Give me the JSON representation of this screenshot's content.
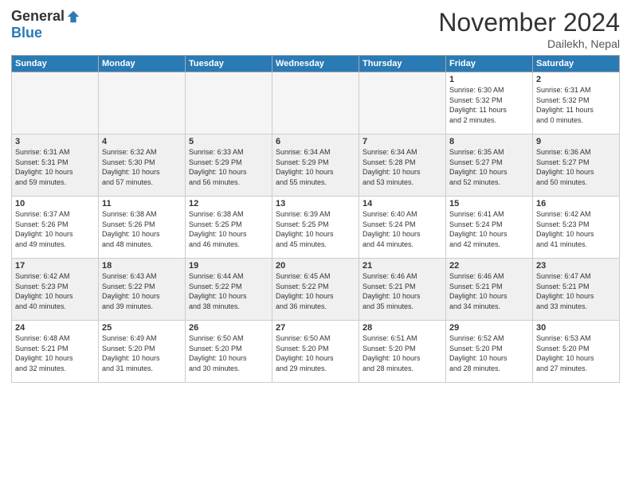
{
  "header": {
    "logo_general": "General",
    "logo_blue": "Blue",
    "month_title": "November 2024",
    "subtitle": "Dailekh, Nepal"
  },
  "weekdays": [
    "Sunday",
    "Monday",
    "Tuesday",
    "Wednesday",
    "Thursday",
    "Friday",
    "Saturday"
  ],
  "weeks": [
    [
      {
        "day": "",
        "info": ""
      },
      {
        "day": "",
        "info": ""
      },
      {
        "day": "",
        "info": ""
      },
      {
        "day": "",
        "info": ""
      },
      {
        "day": "",
        "info": ""
      },
      {
        "day": "1",
        "info": "Sunrise: 6:30 AM\nSunset: 5:32 PM\nDaylight: 11 hours\nand 2 minutes."
      },
      {
        "day": "2",
        "info": "Sunrise: 6:31 AM\nSunset: 5:32 PM\nDaylight: 11 hours\nand 0 minutes."
      }
    ],
    [
      {
        "day": "3",
        "info": "Sunrise: 6:31 AM\nSunset: 5:31 PM\nDaylight: 10 hours\nand 59 minutes."
      },
      {
        "day": "4",
        "info": "Sunrise: 6:32 AM\nSunset: 5:30 PM\nDaylight: 10 hours\nand 57 minutes."
      },
      {
        "day": "5",
        "info": "Sunrise: 6:33 AM\nSunset: 5:29 PM\nDaylight: 10 hours\nand 56 minutes."
      },
      {
        "day": "6",
        "info": "Sunrise: 6:34 AM\nSunset: 5:29 PM\nDaylight: 10 hours\nand 55 minutes."
      },
      {
        "day": "7",
        "info": "Sunrise: 6:34 AM\nSunset: 5:28 PM\nDaylight: 10 hours\nand 53 minutes."
      },
      {
        "day": "8",
        "info": "Sunrise: 6:35 AM\nSunset: 5:27 PM\nDaylight: 10 hours\nand 52 minutes."
      },
      {
        "day": "9",
        "info": "Sunrise: 6:36 AM\nSunset: 5:27 PM\nDaylight: 10 hours\nand 50 minutes."
      }
    ],
    [
      {
        "day": "10",
        "info": "Sunrise: 6:37 AM\nSunset: 5:26 PM\nDaylight: 10 hours\nand 49 minutes."
      },
      {
        "day": "11",
        "info": "Sunrise: 6:38 AM\nSunset: 5:26 PM\nDaylight: 10 hours\nand 48 minutes."
      },
      {
        "day": "12",
        "info": "Sunrise: 6:38 AM\nSunset: 5:25 PM\nDaylight: 10 hours\nand 46 minutes."
      },
      {
        "day": "13",
        "info": "Sunrise: 6:39 AM\nSunset: 5:25 PM\nDaylight: 10 hours\nand 45 minutes."
      },
      {
        "day": "14",
        "info": "Sunrise: 6:40 AM\nSunset: 5:24 PM\nDaylight: 10 hours\nand 44 minutes."
      },
      {
        "day": "15",
        "info": "Sunrise: 6:41 AM\nSunset: 5:24 PM\nDaylight: 10 hours\nand 42 minutes."
      },
      {
        "day": "16",
        "info": "Sunrise: 6:42 AM\nSunset: 5:23 PM\nDaylight: 10 hours\nand 41 minutes."
      }
    ],
    [
      {
        "day": "17",
        "info": "Sunrise: 6:42 AM\nSunset: 5:23 PM\nDaylight: 10 hours\nand 40 minutes."
      },
      {
        "day": "18",
        "info": "Sunrise: 6:43 AM\nSunset: 5:22 PM\nDaylight: 10 hours\nand 39 minutes."
      },
      {
        "day": "19",
        "info": "Sunrise: 6:44 AM\nSunset: 5:22 PM\nDaylight: 10 hours\nand 38 minutes."
      },
      {
        "day": "20",
        "info": "Sunrise: 6:45 AM\nSunset: 5:22 PM\nDaylight: 10 hours\nand 36 minutes."
      },
      {
        "day": "21",
        "info": "Sunrise: 6:46 AM\nSunset: 5:21 PM\nDaylight: 10 hours\nand 35 minutes."
      },
      {
        "day": "22",
        "info": "Sunrise: 6:46 AM\nSunset: 5:21 PM\nDaylight: 10 hours\nand 34 minutes."
      },
      {
        "day": "23",
        "info": "Sunrise: 6:47 AM\nSunset: 5:21 PM\nDaylight: 10 hours\nand 33 minutes."
      }
    ],
    [
      {
        "day": "24",
        "info": "Sunrise: 6:48 AM\nSunset: 5:21 PM\nDaylight: 10 hours\nand 32 minutes."
      },
      {
        "day": "25",
        "info": "Sunrise: 6:49 AM\nSunset: 5:20 PM\nDaylight: 10 hours\nand 31 minutes."
      },
      {
        "day": "26",
        "info": "Sunrise: 6:50 AM\nSunset: 5:20 PM\nDaylight: 10 hours\nand 30 minutes."
      },
      {
        "day": "27",
        "info": "Sunrise: 6:50 AM\nSunset: 5:20 PM\nDaylight: 10 hours\nand 29 minutes."
      },
      {
        "day": "28",
        "info": "Sunrise: 6:51 AM\nSunset: 5:20 PM\nDaylight: 10 hours\nand 28 minutes."
      },
      {
        "day": "29",
        "info": "Sunrise: 6:52 AM\nSunset: 5:20 PM\nDaylight: 10 hours\nand 28 minutes."
      },
      {
        "day": "30",
        "info": "Sunrise: 6:53 AM\nSunset: 5:20 PM\nDaylight: 10 hours\nand 27 minutes."
      }
    ]
  ]
}
